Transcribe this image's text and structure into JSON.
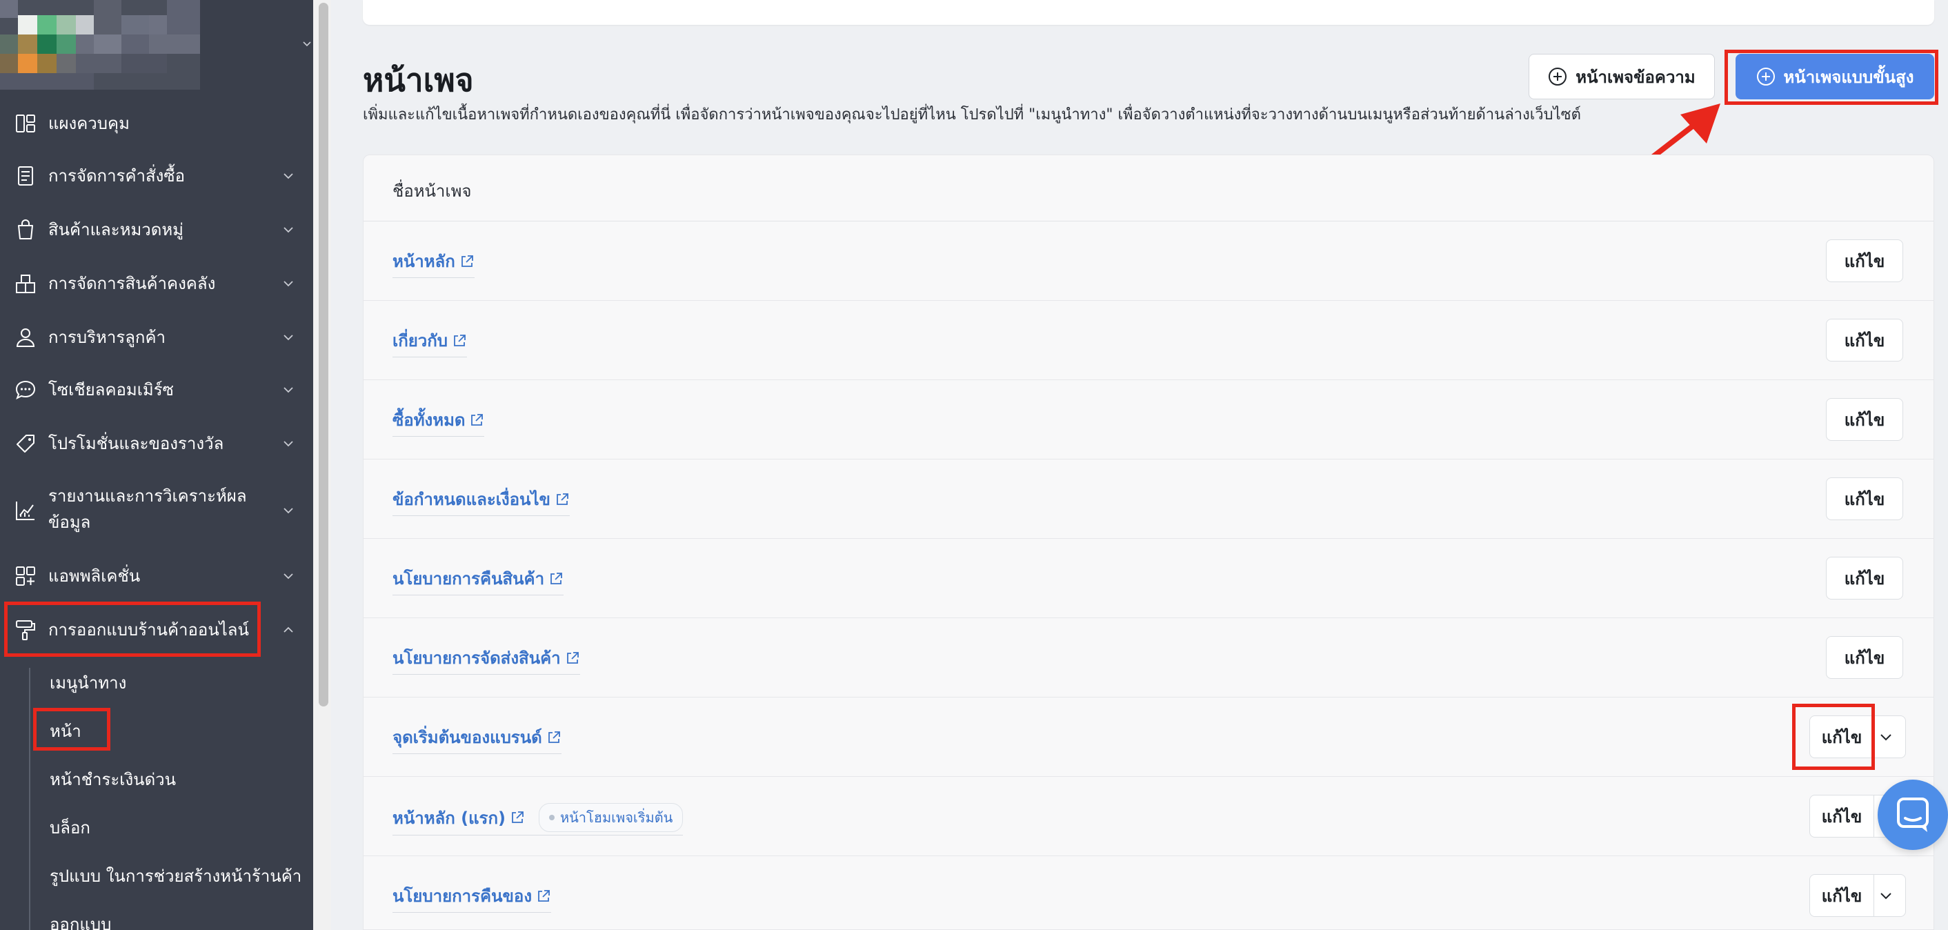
{
  "sidebar": {
    "menu": [
      {
        "label": "แผงควบคุม",
        "icon": "dashboard-icon",
        "has_children": false
      },
      {
        "label": "การจัดการคำสั่งซื้อ",
        "icon": "orders-icon",
        "has_children": true
      },
      {
        "label": "สินค้าและหมวดหมู่",
        "icon": "shopping-bag-icon",
        "has_children": true
      },
      {
        "label": "การจัดการสินค้าคงคลัง",
        "icon": "inventory-icon",
        "has_children": true
      },
      {
        "label": "การบริหารลูกค้า",
        "icon": "customer-icon",
        "has_children": true
      },
      {
        "label": "โซเชียลคอมเมิร์ซ",
        "icon": "chat-icon",
        "has_children": true
      },
      {
        "label": "โปรโมชั่นและของรางวัล",
        "icon": "tag-icon",
        "has_children": true
      },
      {
        "label": "รายงานและการวิเคราะห์ผลข้อมูล",
        "icon": "analytics-icon",
        "has_children": true
      },
      {
        "label": "แอพพลิเคชั่น",
        "icon": "apps-icon",
        "has_children": true
      },
      {
        "label": "การออกแบบร้านค้าออนไลน์",
        "icon": "paint-roller-icon",
        "has_children": true,
        "expanded": true
      }
    ],
    "submenu": [
      {
        "label": "เมนูนำทาง"
      },
      {
        "label": "หน้า",
        "active": true
      },
      {
        "label": "หน้าชำระเงินด่วน"
      },
      {
        "label": "บล็อก"
      },
      {
        "label": "รูปแบบ ในการช่วยสร้างหน้าร้านค้า"
      },
      {
        "label": "ออกแบบ"
      }
    ]
  },
  "main": {
    "title": "หน้าเพจ",
    "description": "เพิ่มและแก้ไขเนื้อหาเพจที่กำหนดเองของคุณที่นี่ เพื่อจัดการว่าหน้าเพจของคุณจะไปอยู่ที่ไหน โปรดไปที่ \"เมนูนำทาง\" เพื่อจัดวางตำแหน่งที่จะวางทางด้านบนเมนูหรือส่วนท้ายด้านล่างเว็บไซต์",
    "buttons": {
      "text_page": "หน้าเพจข้อความ",
      "advanced_page": "หน้าเพจแบบขั้นสูง"
    },
    "table": {
      "header": "ชื่อหน้าเพจ",
      "edit_label": "แก้ไข",
      "rows": [
        {
          "name": "หน้าหลัก",
          "badge": "",
          "dropdown": false
        },
        {
          "name": "เกี่ยวกับ",
          "badge": "",
          "dropdown": false
        },
        {
          "name": "ซื้อทั้งหมด",
          "badge": "",
          "dropdown": false
        },
        {
          "name": "ข้อกำหนดและเงื่อนไข",
          "badge": "",
          "dropdown": false
        },
        {
          "name": "นโยบายการคืนสินค้า",
          "badge": "",
          "dropdown": false
        },
        {
          "name": "นโยบายการจัดส่งสินค้า",
          "badge": "",
          "dropdown": false
        },
        {
          "name": "จุดเริ่มต้นของแบรนด์",
          "badge": "",
          "dropdown": true
        },
        {
          "name": "หน้าหลัก (แรก)",
          "badge": "หน้าโฮมเพจเริ่มต้น",
          "dropdown": true
        },
        {
          "name": "นโยบายการคืนของ",
          "badge": "",
          "dropdown": true
        }
      ]
    }
  },
  "colors": {
    "sidebar_bg": "#3a3f4b",
    "primary": "#4f86e8",
    "link": "#3a73c9",
    "highlight": "#e8271c"
  }
}
